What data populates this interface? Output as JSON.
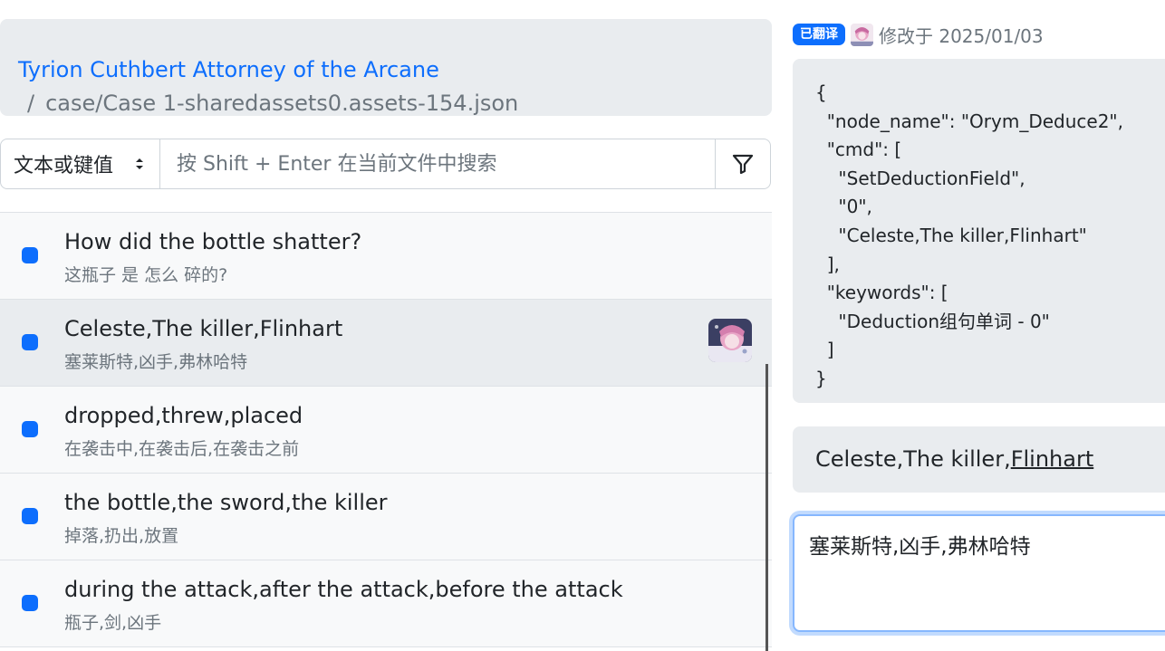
{
  "breadcrumb": {
    "project": "Tyrion Cuthbert Attorney of the Arcane",
    "separator": "/",
    "path": "case/Case 1-sharedassets0.assets-154.json"
  },
  "search": {
    "mode": "文本或键值",
    "placeholder": "按 Shift + Enter 在当前文件中搜索",
    "filter_icon": "filter-icon"
  },
  "entries": [
    {
      "original": "How did the bottle shatter?",
      "translation": "这瓶子 是 怎么 碎的?",
      "has_avatar": false
    },
    {
      "original": "Celeste,The killer,Flinhart",
      "translation": "塞莱斯特,凶手,弗林哈特",
      "has_avatar": true,
      "active": true
    },
    {
      "original": "dropped,threw,placed",
      "translation": "在袭击中,在袭击后,在袭击之前",
      "has_avatar": false
    },
    {
      "original": "the bottle,the sword,the killer",
      "translation": "掉落,扔出,放置",
      "has_avatar": false
    },
    {
      "original": "during the attack,after the attack,before the attack",
      "translation": "瓶子,剑,凶手",
      "has_avatar": false
    }
  ],
  "detail": {
    "badge": "已翻译",
    "modified": "修改于 2025/01/03",
    "json_text": "{\n  \"node_name\": \"Orym_Deduce2\",\n  \"cmd\": [\n    \"SetDeductionField\",\n    \"0\",\n    \"Celeste,The killer,Flinhart\"\n  ],\n  \"keywords\": [\n    \"Deduction组句单词 - 0\"\n  ]\n}",
    "source_prefix": "Celeste,The killer,",
    "source_underlined": "Flinhart",
    "translation_value": "塞莱斯特,凶手,弗林哈特"
  },
  "colors": {
    "accent": "#0d6efd",
    "panel_bg": "#e9ecef",
    "list_bg": "#f8f9fa"
  }
}
